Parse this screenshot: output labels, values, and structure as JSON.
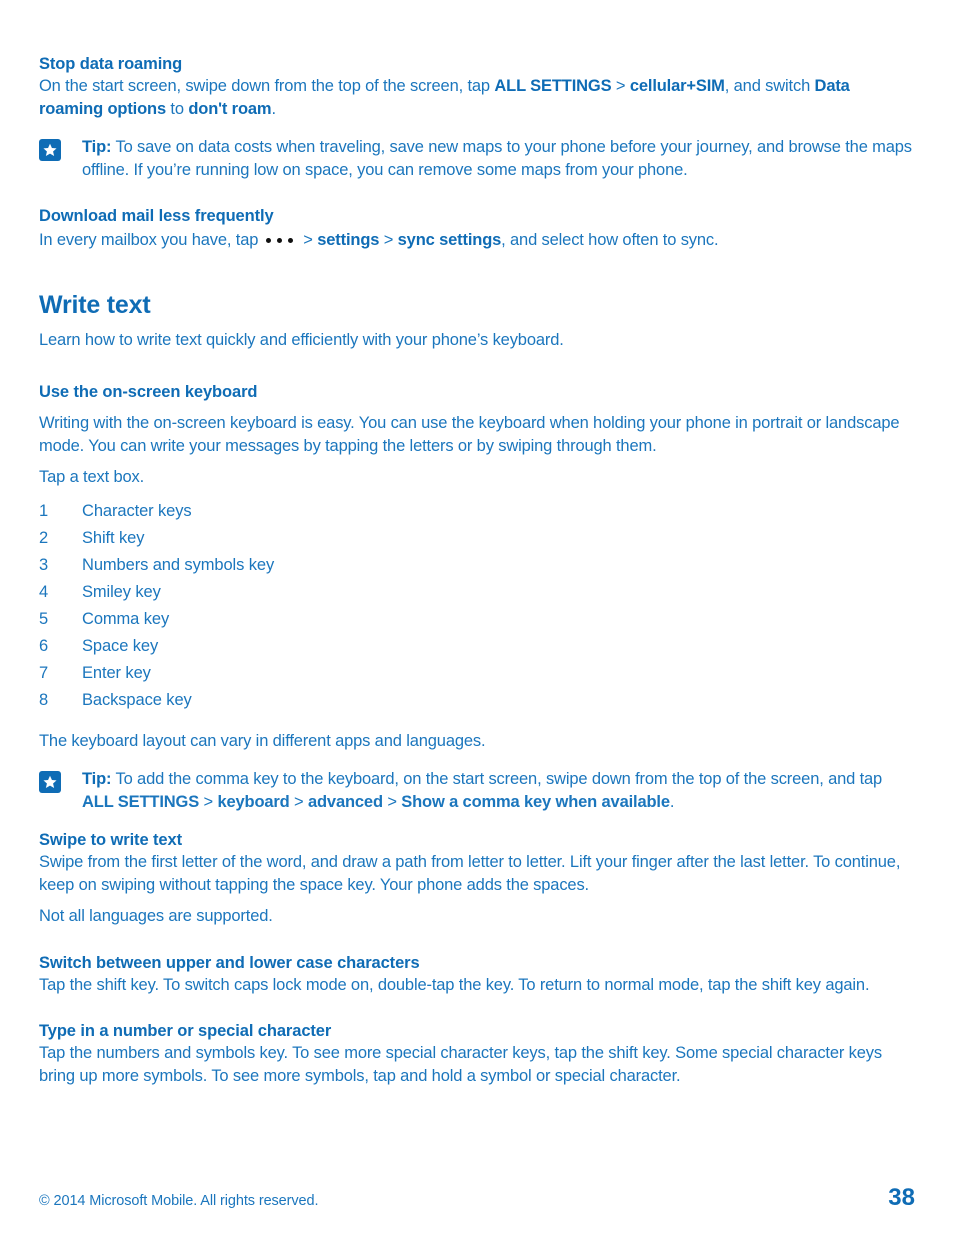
{
  "theme": {
    "accent": "#0f6cb5",
    "body_text": "#1b76bd",
    "background": "#ffffff",
    "ellipsis_dot": "#111111"
  },
  "sections": {
    "stop_data_roaming": {
      "heading": "Stop data roaming",
      "para_1": "On the start screen, swipe down from the top of the screen, tap ",
      "bold_1": "ALL SETTINGS",
      "sep_1": " > ",
      "bold_2": "cellular+SIM",
      "para_2": ", and switch ",
      "bold_3": "Data roaming options",
      "para_3": " to ",
      "bold_4": "don't roam",
      "para_4": "."
    },
    "tip_roaming": {
      "icon": "tip-star-icon",
      "label": "Tip:",
      "text": " To save on data costs when traveling, save new maps to your phone before your journey, and browse the maps offline. If you’re running low on space, you can remove some maps from your phone."
    },
    "download_mail": {
      "heading": "Download mail less frequently",
      "para_1": "In every mailbox you have, tap",
      "icon": "ellipsis-icon",
      "sep_1": "> ",
      "bold_1": "settings",
      "sep_2": " > ",
      "bold_2": "sync settings",
      "para_2": ", and select how often to sync."
    },
    "write_text": {
      "title": "Write text",
      "intro": "Learn how to write text quickly and efficiently with your phone’s keyboard."
    },
    "use_onscreen_keyboard": {
      "heading": "Use the on-screen keyboard",
      "para_1": "Writing with the on-screen keyboard is easy. You can use the keyboard when holding your phone in portrait or landscape mode. You can write your messages by tapping the letters or by swiping through them.",
      "para_2": "Tap a text box.",
      "key_list": [
        {
          "number": "1",
          "label": "Character keys"
        },
        {
          "number": "2",
          "label": "Shift key"
        },
        {
          "number": "3",
          "label": "Numbers and symbols key"
        },
        {
          "number": "4",
          "label": "Smiley key"
        },
        {
          "number": "5",
          "label": "Comma key"
        },
        {
          "number": "6",
          "label": "Space key"
        },
        {
          "number": "7",
          "label": "Enter key"
        },
        {
          "number": "8",
          "label": "Backspace key"
        }
      ],
      "para_3": "The keyboard layout can vary in different apps and languages."
    },
    "tip_comma": {
      "icon": "tip-star-icon",
      "label": "Tip:",
      "text_1": " To add the comma key to the keyboard, on the start screen, swipe down from the top of the screen, and tap ",
      "bold_1": "ALL SETTINGS",
      "sep_1": " > ",
      "bold_2": "keyboard",
      "sep_2": " > ",
      "bold_3": "advanced",
      "sep_3": " > ",
      "bold_4": "Show a comma key when available",
      "text_2": "."
    },
    "swipe_to_write": {
      "heading": "Swipe to write text",
      "para_1": "Swipe from the first letter of the word, and draw a path from letter to letter. Lift your finger after the last letter. To continue, keep on swiping without tapping the space key. Your phone adds the spaces.",
      "para_2": "Not all languages are supported."
    },
    "switch_case": {
      "heading": "Switch between upper and lower case characters",
      "para_1": "Tap the shift key. To switch caps lock mode on, double-tap the key. To return to normal mode, tap the shift key again."
    },
    "type_number": {
      "heading": "Type in a number or special character",
      "para_1": "Tap the numbers and symbols key. To see more special character keys, tap the shift key. Some special character keys bring up more symbols. To see more symbols, tap and hold a symbol or special character."
    }
  },
  "footer": {
    "copyright": "© 2014 Microsoft Mobile. All rights reserved.",
    "page_number": "38"
  }
}
